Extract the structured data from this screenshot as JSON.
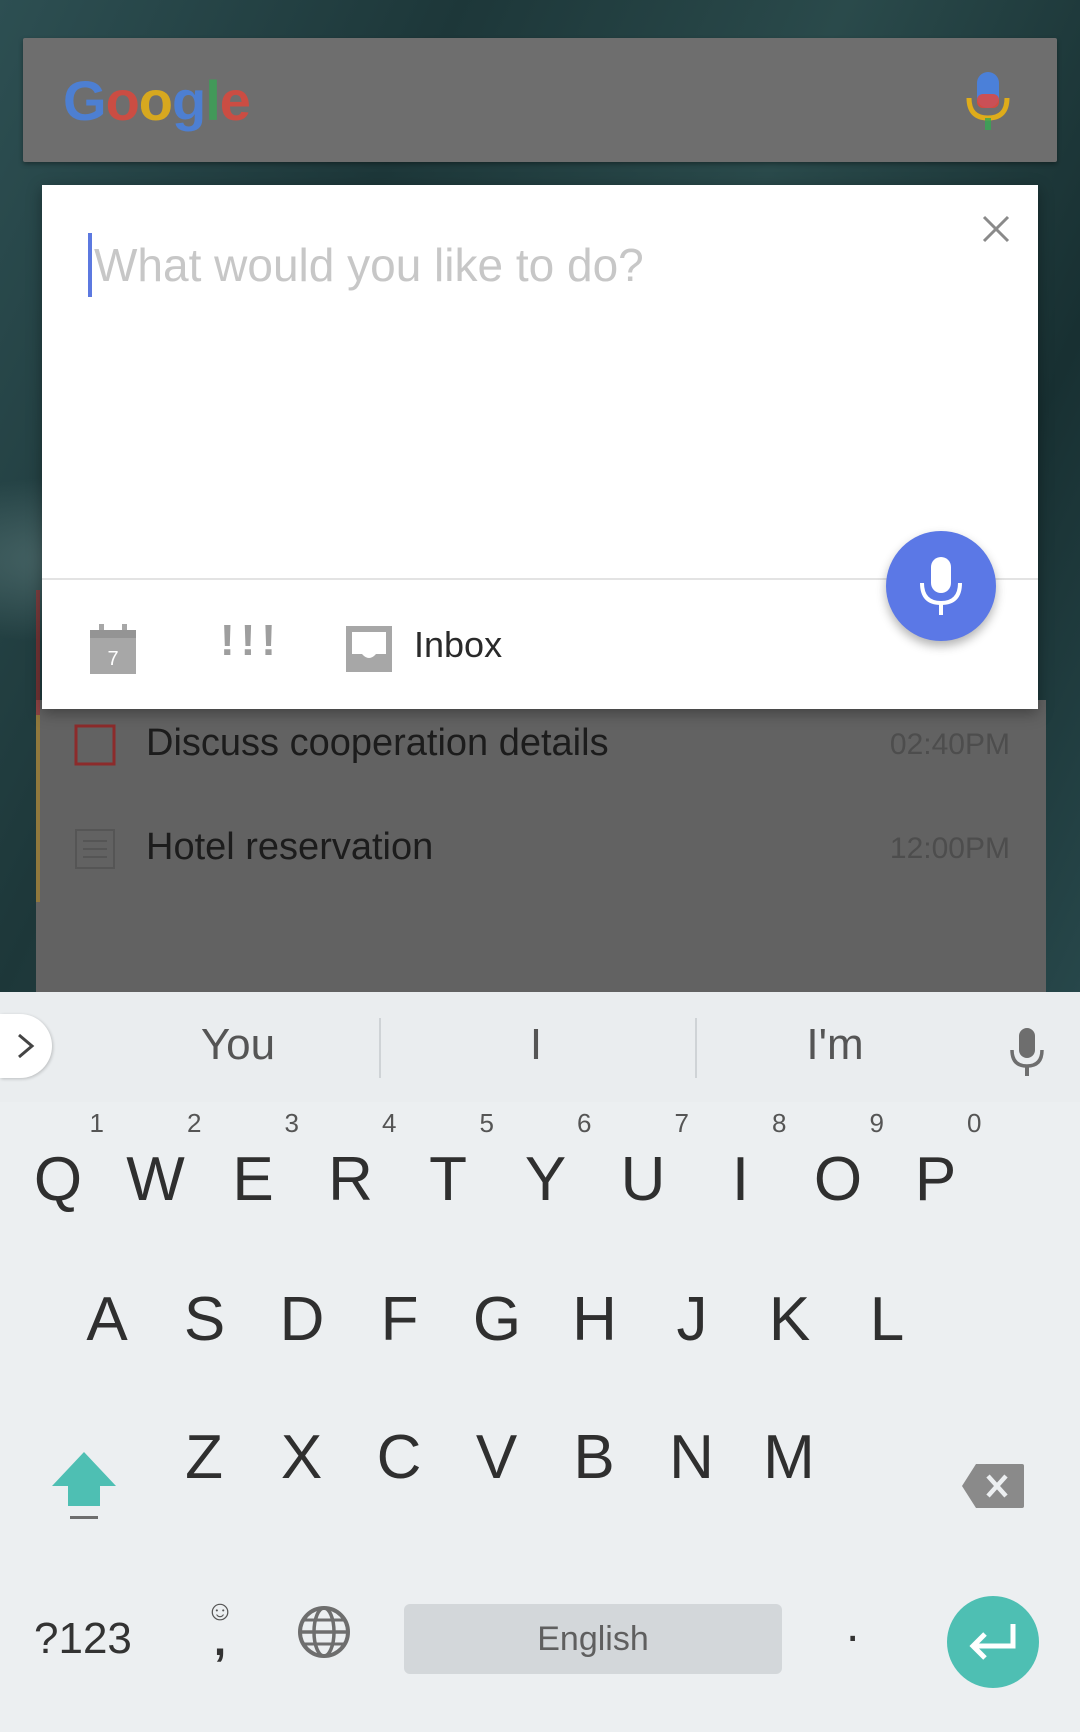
{
  "search_bar": {
    "logo_letters": [
      {
        "char": "G",
        "color": "#4285F4"
      },
      {
        "char": "o",
        "color": "#EA4335"
      },
      {
        "char": "o",
        "color": "#FBBC05"
      },
      {
        "char": "g",
        "color": "#4285F4"
      },
      {
        "char": "l",
        "color": "#34A853"
      },
      {
        "char": "e",
        "color": "#EA4335"
      }
    ],
    "mic_icon": "google-mic-icon"
  },
  "dialog": {
    "input_placeholder": "What would you like to do?",
    "input_value": "",
    "close_icon": "close-icon",
    "voice_icon": "mic-icon",
    "calendar_day": "7",
    "priority_label": "!!!",
    "list_label": "Inbox",
    "accent_color": "#5B78E6"
  },
  "tasks": [
    {
      "title": "Discuss cooperation details",
      "time": "02:40PM",
      "icon": "checkbox-icon"
    },
    {
      "title": "Hotel reservation",
      "time": "12:00PM",
      "icon": "note-icon"
    }
  ],
  "keyboard": {
    "suggestions": [
      "You",
      "I",
      "I'm"
    ],
    "row1": [
      {
        "letter": "Q",
        "hint": "1"
      },
      {
        "letter": "W",
        "hint": "2"
      },
      {
        "letter": "E",
        "hint": "3"
      },
      {
        "letter": "R",
        "hint": "4"
      },
      {
        "letter": "T",
        "hint": "5"
      },
      {
        "letter": "Y",
        "hint": "6"
      },
      {
        "letter": "U",
        "hint": "7"
      },
      {
        "letter": "I",
        "hint": "8"
      },
      {
        "letter": "O",
        "hint": "9"
      },
      {
        "letter": "P",
        "hint": "0"
      }
    ],
    "row2": [
      "A",
      "S",
      "D",
      "F",
      "G",
      "H",
      "J",
      "K",
      "L"
    ],
    "row3": [
      "Z",
      "X",
      "C",
      "V",
      "B",
      "N",
      "M"
    ],
    "symbols_label": "?123",
    "comma_label": ",",
    "space_label": "English",
    "period_label": ".",
    "enter_color": "#4EBFB3",
    "shift_color": "#4EBFB3"
  }
}
